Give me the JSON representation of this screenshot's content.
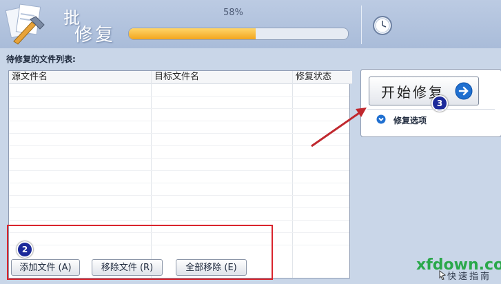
{
  "header": {
    "title_line1": "批",
    "title_line2": "修复",
    "progress_text": "58%",
    "progress_value": 0.58
  },
  "file_list": {
    "title": "待修复的文件列表:",
    "columns": [
      "源文件名",
      "目标文件名",
      "修复状态"
    ],
    "rows": []
  },
  "buttons": {
    "add": "添加文件 (A)",
    "remove": "移除文件 (R)",
    "remove_all": "全部移除 (E)"
  },
  "right_panel": {
    "start_label": "开始修复",
    "options_label": "修复选项"
  },
  "annotations": {
    "badge_2": "2",
    "badge_3": "3"
  },
  "watermark": "xfdown.com",
  "guide_label": "快速指南",
  "colors": {
    "progress_fill": "#f2a51e",
    "highlight_red": "#d9242c",
    "badge_blue": "#1c2a9a",
    "accent_blue": "#1f6fd0"
  },
  "icons": [
    "app-logo-icon",
    "clock-icon",
    "arrow-right-icon",
    "chevron-down-icon",
    "guide-icon"
  ]
}
